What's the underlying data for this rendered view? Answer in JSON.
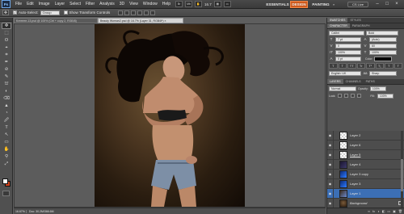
{
  "app": {
    "logo": "Ps",
    "menu": [
      "File",
      "Edit",
      "Image",
      "Layer",
      "Select",
      "Filter",
      "Analysis",
      "3D",
      "View",
      "Window",
      "Help"
    ],
    "zoom_readout": "16.7",
    "workspaces": [
      "ESSENTIALS",
      "DESIGN",
      "PAINTING"
    ],
    "workspace_more": "»",
    "cs_live": "CS Live",
    "window_buttons": [
      "–",
      "□",
      "×"
    ]
  },
  "options": {
    "auto_select_label": "Auto-Select:",
    "auto_select_value": "Group",
    "show_transform": "Show Transform Controls"
  },
  "tools": [
    "✥",
    "⬚",
    "ʘ",
    "⌖",
    "⌗",
    "✒",
    "⊘",
    "✎",
    "⛫",
    "◐",
    "⌫",
    "▲",
    "◔",
    "🖉",
    "T",
    "↖",
    "▭",
    "✋",
    "⚲",
    "⤢"
  ],
  "document": {
    "back_tab": "Kreeeee-13.psd @ 100% (Ctrl + copy 2, RGB/8)",
    "active_tab": "Beauty Woman2.psd @ 16.7% (Layer 31, RGB/8*) ×",
    "status_zoom": "16.67%",
    "status_doc": "Doc: 30.2M/366.6M"
  },
  "character_panel": {
    "tabs": [
      "CHARACTER",
      "PARAGRAPH"
    ],
    "font_family": "Calibri",
    "font_style": "Bold",
    "font_size": "7 pt",
    "leading": "(Auto)",
    "kerning": "0",
    "tracking": "60",
    "vertical_scale": "100%",
    "horizontal_scale": "100%",
    "baseline": "0 pt",
    "color_label": "Color:",
    "format_buttons": [
      "T",
      "T",
      "TT",
      "Tr",
      "T¹",
      "T₁",
      "T",
      "T"
    ],
    "language": "English: UK",
    "antialias": "Sharp"
  },
  "top_right_tabs": [
    "SWATCHES",
    "STYLES"
  ],
  "layers_panel": {
    "tabs": [
      "LAYERS",
      "CHANNELS",
      "PATHS"
    ],
    "blend_mode": "Normal",
    "opacity_label": "Opacity:",
    "opacity_value": "100%",
    "lock_label": "Lock:",
    "fill_label": "Fill:",
    "fill_value": "100%",
    "layers": [
      {
        "name": "Layer 2",
        "thumb": "checker",
        "selected": false,
        "underline": false,
        "italic": false,
        "lock": false
      },
      {
        "name": "Layer 6",
        "thumb": "checker",
        "selected": false,
        "underline": false,
        "italic": false,
        "lock": false
      },
      {
        "name": "Layer 5",
        "thumb": "checker",
        "selected": false,
        "underline": true,
        "italic": false,
        "lock": false
      },
      {
        "name": "Layer 4",
        "thumb": "dark",
        "selected": false,
        "underline": false,
        "italic": false,
        "lock": false
      },
      {
        "name": "Layer 3 copy",
        "thumb": "blue",
        "selected": false,
        "underline": false,
        "italic": false,
        "lock": false
      },
      {
        "name": "Layer 3",
        "thumb": "blue",
        "selected": false,
        "underline": false,
        "italic": false,
        "lock": false
      },
      {
        "name": "Layer 1",
        "thumb": "mixed",
        "selected": true,
        "underline": false,
        "italic": false,
        "lock": false
      },
      {
        "name": "Background",
        "thumb": "bg",
        "selected": false,
        "underline": false,
        "italic": true,
        "lock": true
      }
    ],
    "footer_icons": [
      "∞",
      "fx",
      "◑",
      "◧",
      "▭",
      "▣",
      "🗑"
    ]
  }
}
